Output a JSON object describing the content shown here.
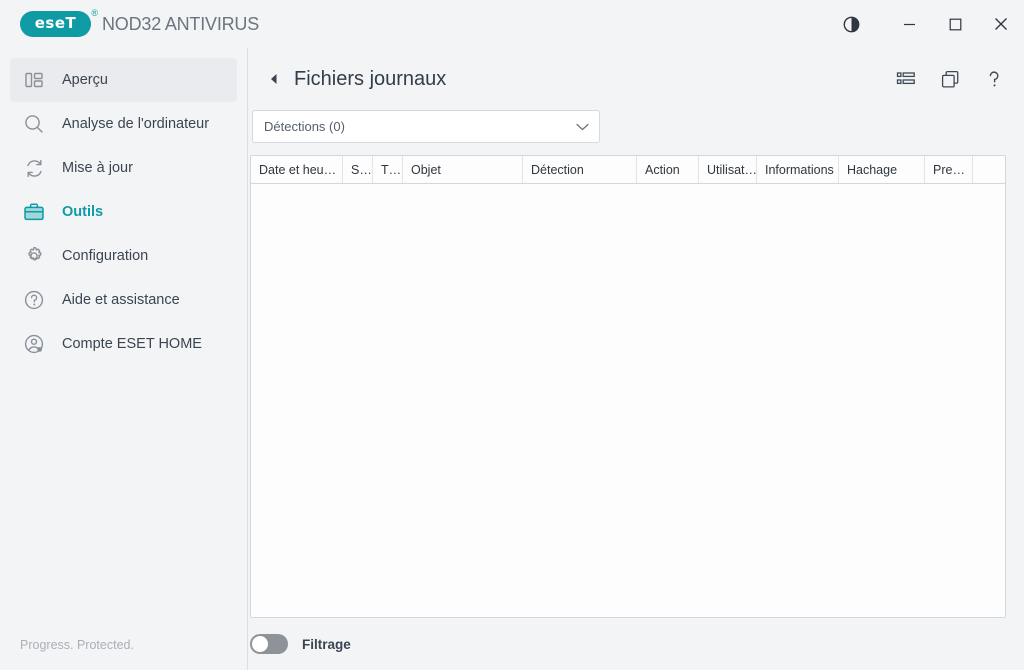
{
  "titlebar": {
    "logo_text": "eseT",
    "logo_registered": "®",
    "product_name": "NOD32 ANTIVIRUS",
    "theme_toggle": "theme-toggle-icon",
    "minimize": "minimize-icon",
    "maximize": "maximize-icon",
    "close": "close-icon"
  },
  "sidebar": {
    "items": [
      {
        "label": "Aperçu",
        "icon": "dashboard-icon",
        "active": false,
        "highlight": true
      },
      {
        "label": "Analyse de l'ordinateur",
        "icon": "magnifier-icon",
        "active": false,
        "highlight": false
      },
      {
        "label": "Mise à jour",
        "icon": "refresh-icon",
        "active": false,
        "highlight": false
      },
      {
        "label": "Outils",
        "icon": "briefcase-icon",
        "active": true,
        "highlight": false
      },
      {
        "label": "Configuration",
        "icon": "gear-icon",
        "active": false,
        "highlight": false
      },
      {
        "label": "Aide et assistance",
        "icon": "question-circle-icon",
        "active": false,
        "highlight": false
      },
      {
        "label": "Compte ESET HOME",
        "icon": "user-circle-icon",
        "active": false,
        "highlight": false
      }
    ],
    "status": "Progress. Protected."
  },
  "main": {
    "back_arrow": "back-arrow-icon",
    "title": "Fichiers journaux",
    "tools": [
      {
        "name": "list-view-icon"
      },
      {
        "name": "copy-windows-icon"
      },
      {
        "name": "help-icon"
      }
    ],
    "filter_select": {
      "value": "Détections (0)",
      "chevron": "chevron-down-icon"
    },
    "table": {
      "columns": [
        {
          "label": "Date et heu…",
          "width": 92
        },
        {
          "label": "S…",
          "width": 30
        },
        {
          "label": "T…",
          "width": 30
        },
        {
          "label": "Objet",
          "width": 120
        },
        {
          "label": "Détection",
          "width": 114
        },
        {
          "label": "Action",
          "width": 62
        },
        {
          "label": "Utilisat…",
          "width": 58
        },
        {
          "label": "Informations",
          "width": 82
        },
        {
          "label": "Hachage",
          "width": 86
        },
        {
          "label": "Pre…",
          "width": 48
        },
        {
          "label": "",
          "width": 34
        }
      ],
      "rows": []
    },
    "footer": {
      "toggle_state": "off",
      "toggle_label": "Filtrage"
    }
  },
  "colors": {
    "brand_teal": "#0f9ba4",
    "text_primary": "#3b4551",
    "text_muted": "#8a9099",
    "sidebar_bg": "#f2f4f6",
    "table_bg": "#fdfdfd",
    "border": "#d4d7db"
  }
}
